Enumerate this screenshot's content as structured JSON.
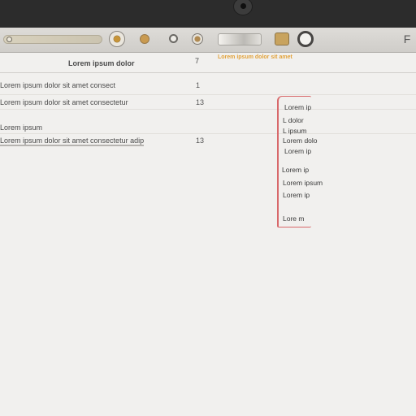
{
  "toolbar": {
    "icons": [
      "slider-icon",
      "record-icon",
      "dot-icon",
      "circle-icon",
      "target-icon",
      "pen-tool-icon",
      "folder-icon",
      "stop-icon",
      "format-icon"
    ],
    "right_glyph": "F"
  },
  "link": {
    "label": "Lorem ipsum dolor sit amet"
  },
  "table": {
    "header": {
      "left": "Lorem ipsum dolor",
      "right": "7"
    },
    "rows": [
      {
        "text": "Lorem ipsum dolor sit amet consect",
        "num": "1",
        "selected": false
      },
      {
        "text": "Lorem ipsum dolor sit amet consectetur",
        "num": "13",
        "selected": false
      },
      {
        "text": "Lorem ipsum",
        "num": "",
        "selected": false
      },
      {
        "text": "Lorem ipsum dolor sit amet consectetur adip",
        "num": "13",
        "selected": true
      }
    ]
  },
  "note": {
    "items": [
      "Lorem ip",
      "L dolor",
      "L ipsum",
      "Lorem dolo",
      "Lorem ip",
      "Lorem ip",
      "Lorem ipsum",
      "Lorem ip",
      "Lore  m"
    ]
  }
}
